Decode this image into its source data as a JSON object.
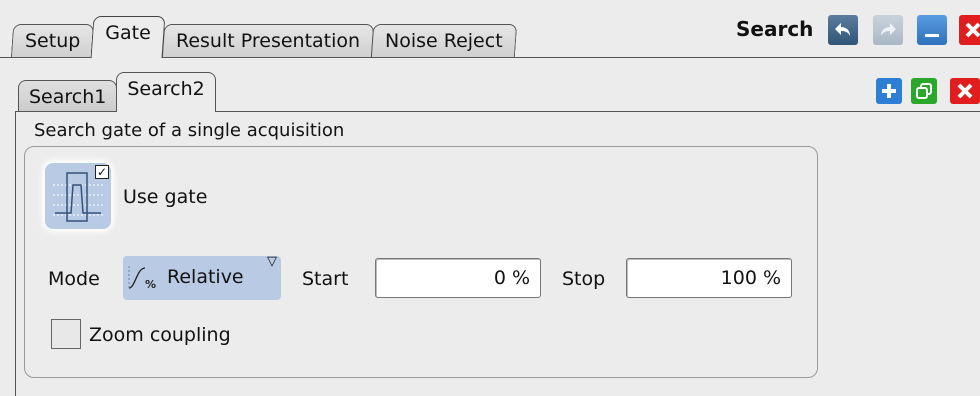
{
  "top_tabs": [
    "Setup",
    "Gate",
    "Result Presentation",
    "Noise Reject"
  ],
  "active_top_tab": "Gate",
  "dialog_title": "Search",
  "inner_tabs": [
    "Search1",
    "Search2"
  ],
  "active_inner_tab": "Search2",
  "section_title": "Search gate of a single acquisition",
  "use_gate": {
    "label": "Use gate",
    "checked": true
  },
  "mode": {
    "label": "Mode",
    "value": "Relative"
  },
  "start": {
    "label": "Start",
    "value": "0 %"
  },
  "stop": {
    "label": "Stop",
    "value": "100 %"
  },
  "zoom_coupling": {
    "label": "Zoom coupling",
    "checked": false
  },
  "colors": {
    "button_blue": "#2d7fd6",
    "button_green": "#2aa82a",
    "button_red": "#e21d1d",
    "selector_fill": "#b9cbe4"
  }
}
